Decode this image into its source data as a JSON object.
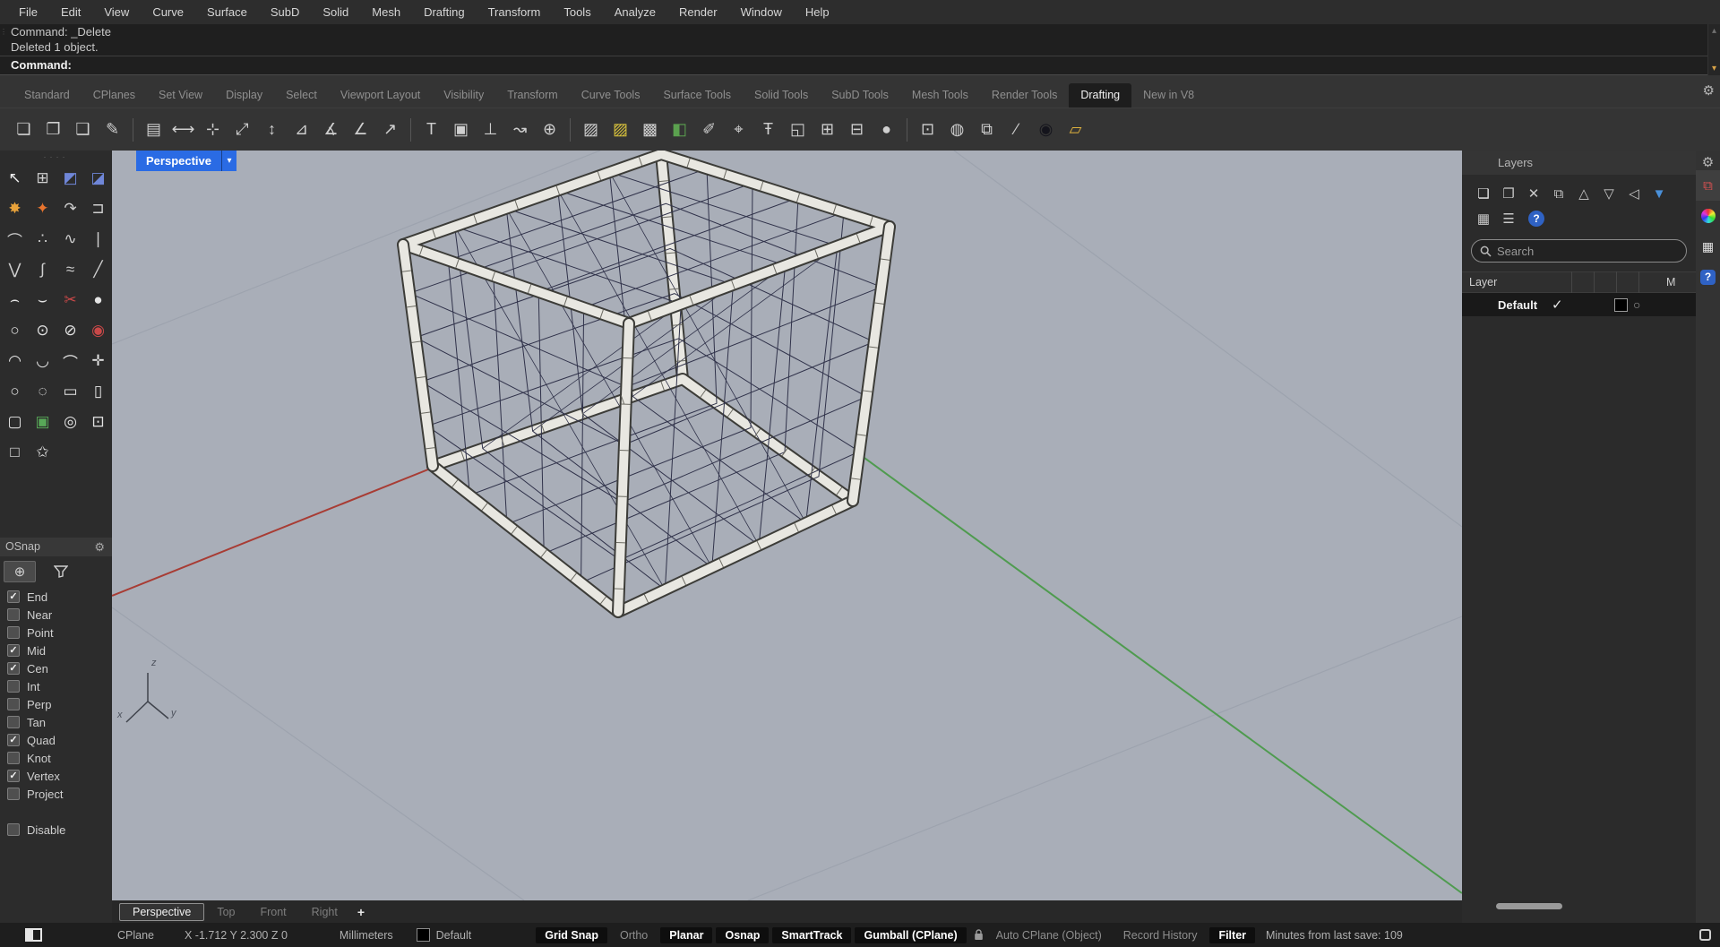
{
  "icons": {
    "gear": "⚙",
    "check": "✓",
    "chevron_down": "▾",
    "chevron_up": "▴",
    "grip_dots": "····",
    "osnap_marker": "⊕",
    "material_circle": "○",
    "hamburger": "☰",
    "grid": "▦",
    "layers_tab": "⧉",
    "question": "?"
  },
  "colors": {
    "accent_blue": "#2a6be4",
    "viewport_bg": "#a9aeb8",
    "axis_red": "#a83c34",
    "axis_green": "#4f9b4f",
    "lattice": "#30324a"
  },
  "menu_bar": {
    "items": [
      "File",
      "Edit",
      "View",
      "Curve",
      "Surface",
      "SubD",
      "Solid",
      "Mesh",
      "Drafting",
      "Transform",
      "Tools",
      "Analyze",
      "Render",
      "Window",
      "Help"
    ]
  },
  "command_area": {
    "history": [
      "Command: _Delete",
      "Deleted 1 object."
    ],
    "prompt": "Command:"
  },
  "toolbar_tabs": {
    "items": [
      {
        "label": "Standard"
      },
      {
        "label": "CPlanes"
      },
      {
        "label": "Set View"
      },
      {
        "label": "Display"
      },
      {
        "label": "Select"
      },
      {
        "label": "Viewport Layout"
      },
      {
        "label": "Visibility"
      },
      {
        "label": "Transform"
      },
      {
        "label": "Curve Tools"
      },
      {
        "label": "Surface Tools"
      },
      {
        "label": "Solid Tools"
      },
      {
        "label": "SubD Tools"
      },
      {
        "label": "Mesh Tools"
      },
      {
        "label": "Render Tools"
      },
      {
        "label": "Drafting",
        "active": true
      },
      {
        "label": "New in V8"
      }
    ]
  },
  "toolbar_icons": [
    {
      "name": "new-file",
      "glyph": "❏"
    },
    {
      "name": "open-file",
      "glyph": "❐"
    },
    {
      "name": "save-file",
      "glyph": "❑"
    },
    {
      "name": "options",
      "glyph": "✎"
    },
    {
      "sep": true
    },
    {
      "name": "notes",
      "glyph": "▤"
    },
    {
      "name": "dim-horizontal",
      "glyph": "⟷"
    },
    {
      "name": "dim-point",
      "glyph": "⊹"
    },
    {
      "name": "dim-aligned",
      "glyph": "⤢"
    },
    {
      "name": "dim-vertical",
      "glyph": "↕"
    },
    {
      "name": "dim-rotated",
      "glyph": "⊿"
    },
    {
      "name": "dim-45",
      "glyph": "∡"
    },
    {
      "name": "dim-angle",
      "glyph": "∠"
    },
    {
      "name": "leader",
      "glyph": "↗"
    },
    {
      "sep": true
    },
    {
      "name": "text",
      "glyph": "T"
    },
    {
      "name": "text-frame",
      "glyph": "▣"
    },
    {
      "name": "dim-ordinate",
      "glyph": "⊥"
    },
    {
      "name": "revision-cloud",
      "glyph": "↝"
    },
    {
      "name": "circle-plus",
      "glyph": "⊕"
    },
    {
      "sep": true
    },
    {
      "name": "hatch",
      "glyph": "▨"
    },
    {
      "name": "hatch-yellow",
      "glyph": "▨",
      "color": "#d8c23c"
    },
    {
      "name": "hatch-solid",
      "glyph": "▩"
    },
    {
      "name": "fill-color",
      "glyph": "◧",
      "color": "#5ba14f"
    },
    {
      "name": "dim-edit",
      "glyph": "✐"
    },
    {
      "name": "dim-recenter",
      "glyph": "⌖"
    },
    {
      "name": "text-height",
      "glyph": "Ŧ"
    },
    {
      "name": "detail-view",
      "glyph": "◱"
    },
    {
      "name": "table",
      "glyph": "⊞"
    },
    {
      "name": "table-align",
      "glyph": "⊟"
    },
    {
      "name": "annotation-dot",
      "glyph": "●"
    },
    {
      "sep": true
    },
    {
      "name": "print",
      "glyph": "⊡"
    },
    {
      "name": "world-annotation",
      "glyph": "◍"
    },
    {
      "name": "copy-detail",
      "glyph": "⧉"
    },
    {
      "name": "pen-stroke",
      "glyph": "∕"
    },
    {
      "name": "black-sphere",
      "glyph": "◉",
      "color": "#14141c"
    },
    {
      "name": "open-folder",
      "glyph": "▱",
      "color": "#dfb23e"
    }
  ],
  "left_toolbox": {
    "tools": [
      {
        "name": "select",
        "glyph": "↖",
        "color": "#ececec"
      },
      {
        "name": "points",
        "glyph": "⊞",
        "color": "#cfcfcf"
      },
      {
        "name": "move-cplane",
        "glyph": "◩",
        "color": "#6f86d8"
      },
      {
        "name": "set-cplane",
        "glyph": "◪",
        "color": "#6f86d8"
      },
      {
        "name": "explode",
        "glyph": "✸",
        "color": "#e8a23a"
      },
      {
        "name": "blast",
        "glyph": "✦",
        "color": "#e8742e"
      },
      {
        "name": "curve-rebuild",
        "glyph": "↷",
        "color": "#cfcfcf"
      },
      {
        "name": "curve-extend",
        "glyph": "⊐",
        "color": "#cfcfcf"
      },
      {
        "name": "arc-points",
        "glyph": "⌒",
        "color": "#cfcfcf"
      },
      {
        "name": "control-points",
        "glyph": "∴",
        "color": "#cfcfcf"
      },
      {
        "name": "sketch-curve",
        "glyph": "∿",
        "color": "#cfcfcf"
      },
      {
        "name": "line-vertical",
        "glyph": "❘",
        "color": "#cfcfcf"
      },
      {
        "name": "polyline",
        "glyph": "⋁",
        "color": "#cfcfcf"
      },
      {
        "name": "curve-interpolate",
        "glyph": "∫",
        "color": "#cfcfcf"
      },
      {
        "name": "curve-freeform",
        "glyph": "≈",
        "color": "#cfcfcf"
      },
      {
        "name": "line",
        "glyph": "╱",
        "color": "#cfcfcf"
      },
      {
        "name": "blend-curve",
        "glyph": "⌢",
        "color": "#e4e4e4"
      },
      {
        "name": "adjust-blend",
        "glyph": "⌣",
        "color": "#e4e4e4"
      },
      {
        "name": "refit-curve",
        "glyph": "✂",
        "color": "#c84848"
      },
      {
        "name": "circle-solid",
        "glyph": "●",
        "color": "#e4e4e4"
      },
      {
        "name": "circle",
        "glyph": "○",
        "color": "#e4e4e4"
      },
      {
        "name": "circle-point",
        "glyph": "⊙",
        "color": "#e4e4e4"
      },
      {
        "name": "circle-diameter",
        "glyph": "⊘",
        "color": "#e4e4e4"
      },
      {
        "name": "circle-deformable",
        "glyph": "◉",
        "color": "#c84848"
      },
      {
        "name": "arc",
        "glyph": "◠",
        "color": "#e4e4e4"
      },
      {
        "name": "arc-cse",
        "glyph": "◡",
        "color": "#e4e4e4"
      },
      {
        "name": "arc-tangent",
        "glyph": "⌒",
        "color": "#e4e4e4"
      },
      {
        "name": "arc-plus",
        "glyph": "✛",
        "color": "#e4e4e4"
      },
      {
        "name": "ellipse",
        "glyph": "○",
        "color": "#e4e4e4"
      },
      {
        "name": "ellipse-diameter",
        "glyph": "◌",
        "color": "#e4e4e4"
      },
      {
        "name": "rectangle",
        "glyph": "▭",
        "color": "#e4e4e4"
      },
      {
        "name": "rectangle-vertical",
        "glyph": "▯",
        "color": "#e4e4e4"
      },
      {
        "name": "rectangle-rounded",
        "glyph": "▢",
        "color": "#e4e4e4"
      },
      {
        "name": "picture-frame",
        "glyph": "▣",
        "color": "#58a858"
      },
      {
        "name": "point-circle",
        "glyph": "◎",
        "color": "#e4e4e4"
      },
      {
        "name": "point-square",
        "glyph": "⊡",
        "color": "#e4e4e4"
      },
      {
        "name": "rectangle-plain",
        "glyph": "□",
        "color": "#e4e4e4"
      },
      {
        "name": "star",
        "glyph": "✩",
        "color": "#e4e4e4"
      }
    ]
  },
  "osnap": {
    "title": "OSnap",
    "toggles": [
      {
        "label": "End",
        "checked": true
      },
      {
        "label": "Near",
        "checked": false
      },
      {
        "label": "Point",
        "checked": false
      },
      {
        "label": "Mid",
        "checked": true
      },
      {
        "label": "Cen",
        "checked": true
      },
      {
        "label": "Int",
        "checked": false
      },
      {
        "label": "Perp",
        "checked": false
      },
      {
        "label": "Tan",
        "checked": false
      },
      {
        "label": "Quad",
        "checked": true
      },
      {
        "label": "Knot",
        "checked": false
      },
      {
        "label": "Vertex",
        "checked": true
      },
      {
        "label": "Project",
        "checked": false
      }
    ],
    "disable": {
      "label": "Disable",
      "checked": false
    }
  },
  "viewport": {
    "label": "Perspective",
    "axis_labels": {
      "x": "x",
      "y": "y",
      "z": "z"
    },
    "tabs": [
      {
        "label": "Perspective",
        "active": true
      },
      {
        "label": "Top",
        "active": false
      },
      {
        "label": "Front",
        "active": false
      },
      {
        "label": "Right",
        "active": false
      }
    ],
    "add_tab": "+"
  },
  "layers_panel": {
    "title": "Layers",
    "toolbar_row1": [
      {
        "name": "new-layer",
        "glyph": "❏",
        "color": "#e8e8e8"
      },
      {
        "name": "new-sublayer",
        "glyph": "❐"
      },
      {
        "name": "delete-layer",
        "glyph": "✕"
      },
      {
        "name": "duplicate-layer",
        "glyph": "⧉"
      },
      {
        "name": "move-up",
        "glyph": "△"
      },
      {
        "name": "move-down",
        "glyph": "▽"
      },
      {
        "name": "move-left",
        "glyph": "◁"
      },
      {
        "name": "layer-filter",
        "glyph": "▼",
        "color": "#4a90d9"
      }
    ],
    "toolbar_row2": [
      {
        "name": "layer-grid",
        "glyph": "▦"
      },
      {
        "name": "layer-menu",
        "glyph": "☰"
      },
      {
        "name": "help",
        "glyph": "?",
        "color": "#ffffff",
        "bg": "#2f62c4"
      }
    ],
    "search_placeholder": "Search",
    "list_header": {
      "name_col": "Layer",
      "material_col": "M"
    },
    "layers": [
      {
        "name": "Default",
        "current": true
      }
    ]
  },
  "status_bar": {
    "cplane": "CPlane",
    "coords": "X -1.712 Y 2.300 Z 0",
    "units": "Millimeters",
    "layer": "Default",
    "toggles": [
      {
        "label": "Grid Snap",
        "active": true
      },
      {
        "label": "Ortho",
        "active": false
      },
      {
        "label": "Planar",
        "active": true
      },
      {
        "label": "Osnap",
        "active": true
      },
      {
        "label": "SmartTrack",
        "active": true
      },
      {
        "label": "Gumball (CPlane)",
        "active": true
      },
      {
        "label": "Auto CPlane (Object)",
        "active": false
      },
      {
        "label": "Record History",
        "active": false
      },
      {
        "label": "Filter",
        "active": true
      }
    ],
    "save_info": "Minutes from last save: 109"
  }
}
